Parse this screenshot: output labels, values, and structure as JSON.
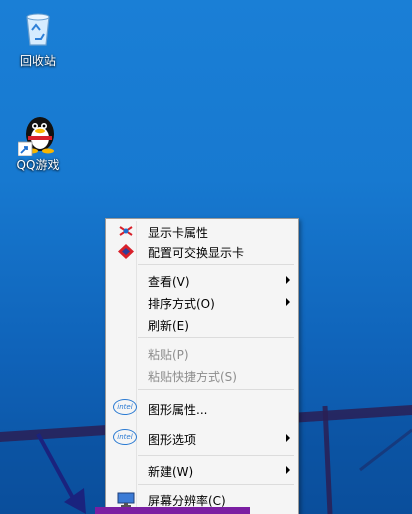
{
  "desktop": {
    "icons": [
      {
        "label": "回收站",
        "icon": "recycle-bin-icon"
      },
      {
        "label": "QQ游戏",
        "icon": "qq-penguin-icon"
      }
    ]
  },
  "context_menu": {
    "items": [
      {
        "label": "显示卡属性",
        "icon": "graphics-card-icon"
      },
      {
        "label": "配置可交换显示卡",
        "icon": "switchable-graphics-icon"
      },
      {
        "label": "查看(V)",
        "submenu": true
      },
      {
        "label": "排序方式(O)",
        "submenu": true
      },
      {
        "label": "刷新(E)"
      },
      {
        "label": "粘贴(P)",
        "disabled": true
      },
      {
        "label": "粘贴快捷方式(S)",
        "disabled": true
      },
      {
        "label": "图形属性...",
        "icon": "intel-icon"
      },
      {
        "label": "图形选项",
        "icon": "intel-icon",
        "submenu": true
      },
      {
        "label": "新建(W)",
        "submenu": true
      },
      {
        "label": "屏幕分辨率(C)",
        "icon": "screen-resolution-icon"
      }
    ],
    "intel_text": "intel"
  },
  "colors": {
    "desktop_blue": "#1779d0",
    "menu_bg": "#f5f5f5",
    "highlight_purple": "#7b1fa2",
    "arrow_navy": "#1a237e"
  }
}
